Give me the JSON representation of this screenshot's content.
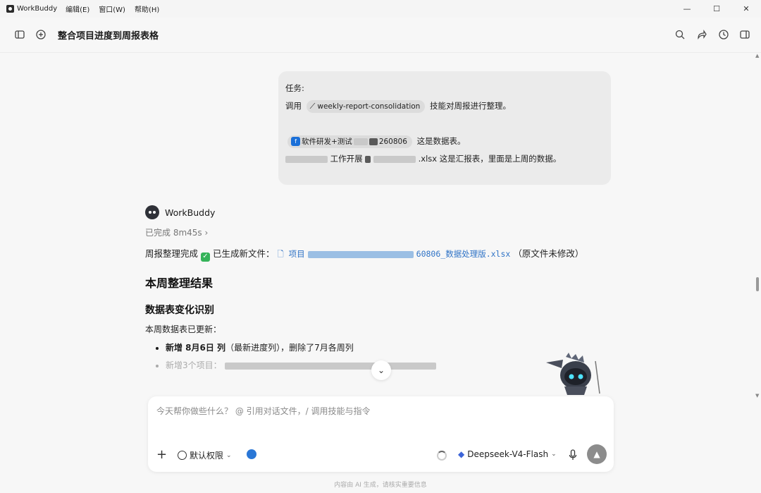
{
  "titlebar": {
    "app_name": "WorkBuddy",
    "menus": [
      "编辑(E)",
      "窗口(W)",
      "帮助(H)"
    ],
    "min": "—",
    "max": "☐",
    "close": "✕"
  },
  "header": {
    "title": "整合项目进度到周报表格",
    "icons": [
      "sidebar-toggle-icon",
      "new-chat-icon",
      "search-icon",
      "share-icon",
      "history-icon",
      "panel-icon"
    ]
  },
  "user_message": {
    "line1": "任务:",
    "line2_prefix": "调用",
    "skill_chip": "weekly-report-consolidation",
    "line2_suffix": "技能对周报进行整理。",
    "file_chip_visible": "软件研发+测试",
    "file_chip_suffix": "260806",
    "line4_suffix": "这是数据表。",
    "line5_visible_mid": "工作开展",
    "line5_file_ext": ".xlsx",
    "line5_suffix": "这是汇报表，里面是上周的数据。"
  },
  "assistant": {
    "name": "WorkBuddy",
    "status": "已完成 8m45s",
    "status_chevron": "›",
    "summary_prefix": "周报整理完成",
    "summary_mid": "已生成新文件：",
    "file_name_visible": "项目",
    "file_name_suffix": "60806_数据处理版.xlsx",
    "summary_suffix": "（原文件未修改）",
    "heading": "本周整理结果",
    "subheading": "数据表变化识别",
    "para": "本周数据表已更新：",
    "bullet1_bold": "新增 8月6日 列",
    "bullet1_rest": "（最新进度列），删除了7月各周列",
    "bullet2": "新增3个项目："
  },
  "composer": {
    "placeholder": "今天帮你做些什么？ @ 引用对话文件，/ 调用技能与指令",
    "permission": "默认权限",
    "model": "Deepseek-V4-Flash"
  },
  "footer": "内容由 AI 生成，请核实重要信息"
}
